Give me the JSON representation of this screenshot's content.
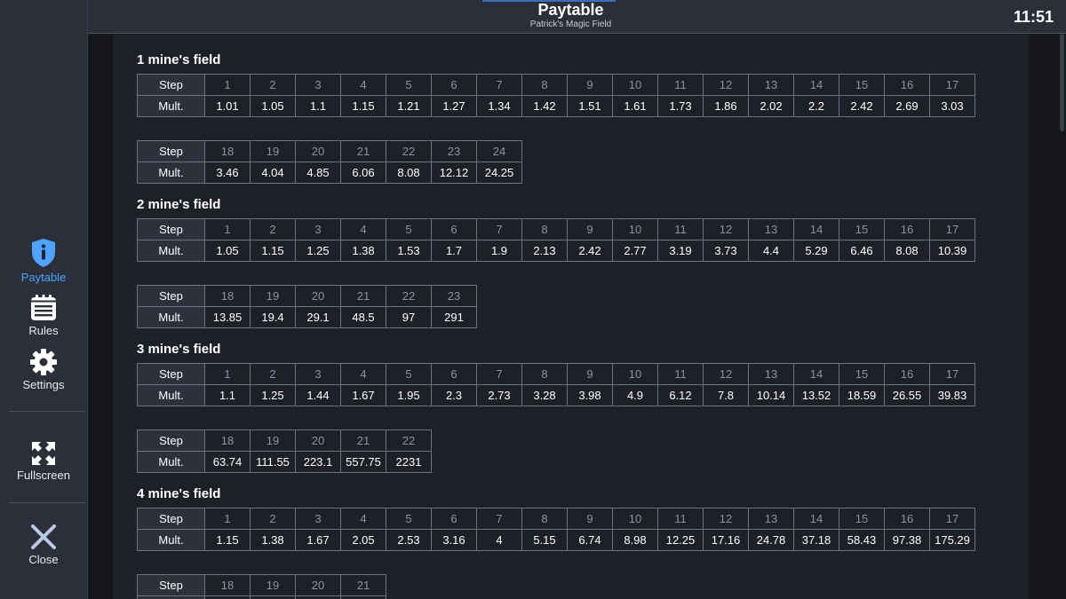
{
  "header": {
    "title": "Paytable",
    "subtitle": "Patrick's Magic Field",
    "clock": "11:51"
  },
  "sidebar": {
    "items": [
      {
        "label": "Paytable",
        "icon": "shield-info-icon",
        "active": true
      },
      {
        "label": "Rules",
        "icon": "notepad-icon"
      },
      {
        "label": "Settings",
        "icon": "gear-icon"
      },
      {
        "label": "Fullscreen",
        "icon": "fullscreen-icon"
      },
      {
        "label": "Close",
        "icon": "close-icon"
      }
    ]
  },
  "table_labels": {
    "step": "Step",
    "mult": "Mult."
  },
  "fields": [
    {
      "title": "1 mine's field",
      "rows": [
        {
          "steps": [
            "1",
            "2",
            "3",
            "4",
            "5",
            "6",
            "7",
            "8",
            "9",
            "10",
            "11",
            "12",
            "13",
            "14",
            "15",
            "16",
            "17"
          ],
          "mults": [
            "1.01",
            "1.05",
            "1.1",
            "1.15",
            "1.21",
            "1.27",
            "1.34",
            "1.42",
            "1.51",
            "1.61",
            "1.73",
            "1.86",
            "2.02",
            "2.2",
            "2.42",
            "2.69",
            "3.03"
          ]
        },
        {
          "steps": [
            "18",
            "19",
            "20",
            "21",
            "22",
            "23",
            "24"
          ],
          "mults": [
            "3.46",
            "4.04",
            "4.85",
            "6.06",
            "8.08",
            "12.12",
            "24.25"
          ]
        }
      ]
    },
    {
      "title": "2 mine's field",
      "rows": [
        {
          "steps": [
            "1",
            "2",
            "3",
            "4",
            "5",
            "6",
            "7",
            "8",
            "9",
            "10",
            "11",
            "12",
            "13",
            "14",
            "15",
            "16",
            "17"
          ],
          "mults": [
            "1.05",
            "1.15",
            "1.25",
            "1.38",
            "1.53",
            "1.7",
            "1.9",
            "2.13",
            "2.42",
            "2.77",
            "3.19",
            "3.73",
            "4.4",
            "5.29",
            "6.46",
            "8.08",
            "10.39"
          ]
        },
        {
          "steps": [
            "18",
            "19",
            "20",
            "21",
            "22",
            "23"
          ],
          "mults": [
            "13.85",
            "19.4",
            "29.1",
            "48.5",
            "97",
            "291"
          ]
        }
      ]
    },
    {
      "title": "3 mine's field",
      "rows": [
        {
          "steps": [
            "1",
            "2",
            "3",
            "4",
            "5",
            "6",
            "7",
            "8",
            "9",
            "10",
            "11",
            "12",
            "13",
            "14",
            "15",
            "16",
            "17"
          ],
          "mults": [
            "1.1",
            "1.25",
            "1.44",
            "1.67",
            "1.95",
            "2.3",
            "2.73",
            "3.28",
            "3.98",
            "4.9",
            "6.12",
            "7.8",
            "10.14",
            "13.52",
            "18.59",
            "26.55",
            "39.83"
          ]
        },
        {
          "steps": [
            "18",
            "19",
            "20",
            "21",
            "22"
          ],
          "mults": [
            "63.74",
            "111.55",
            "223.1",
            "557.75",
            "2231"
          ]
        }
      ]
    },
    {
      "title": "4 mine's field",
      "rows": [
        {
          "steps": [
            "1",
            "2",
            "3",
            "4",
            "5",
            "6",
            "7",
            "8",
            "9",
            "10",
            "11",
            "12",
            "13",
            "14",
            "15",
            "16",
            "17"
          ],
          "mults": [
            "1.15",
            "1.38",
            "1.67",
            "2.05",
            "2.53",
            "3.16",
            "4",
            "5.15",
            "6.74",
            "8.98",
            "12.25",
            "17.16",
            "24.78",
            "37.18",
            "58.43",
            "97.38",
            "175.29"
          ]
        },
        {
          "steps": [
            "18",
            "19",
            "20",
            "21"
          ],
          "mults": [
            "",
            "",
            "",
            ""
          ]
        }
      ]
    }
  ]
}
